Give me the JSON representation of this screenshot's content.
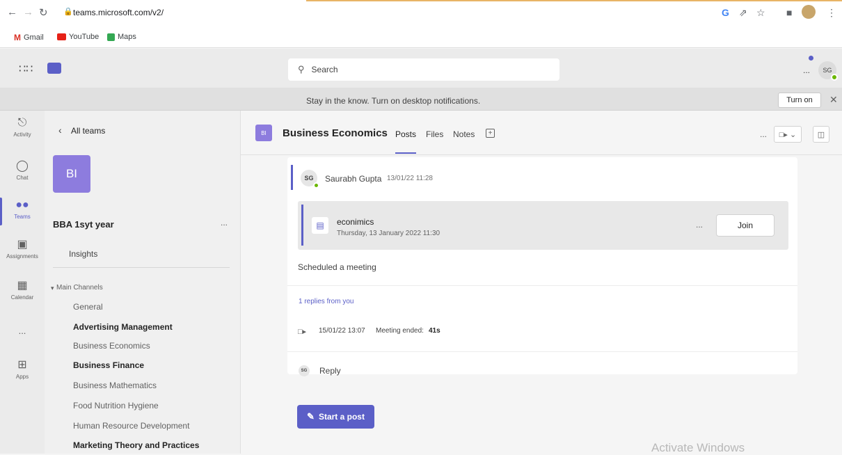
{
  "browser": {
    "url": "teams.microsoft.com/v2/",
    "bookmarks": [
      {
        "label": "Gmail",
        "color": "#d93025"
      },
      {
        "label": "YouTube",
        "color": "#e62117"
      },
      {
        "label": "Maps",
        "color": "#34a853"
      }
    ]
  },
  "header": {
    "search_placeholder": "Search",
    "more_label": "...",
    "avatar_initials": "SG"
  },
  "notification": {
    "text": "Stay in the know. Turn on desktop notifications.",
    "button": "Turn on"
  },
  "rail": {
    "items": [
      {
        "label": "Activity",
        "icon": "bell-icon"
      },
      {
        "label": "Chat",
        "icon": "chat-icon"
      },
      {
        "label": "Teams",
        "icon": "teams-icon",
        "active": true
      },
      {
        "label": "Assignments",
        "icon": "assignments-icon"
      },
      {
        "label": "Calendar",
        "icon": "calendar-icon"
      },
      {
        "label": "...",
        "icon": "more-icon"
      },
      {
        "label": "Apps",
        "icon": "apps-icon"
      }
    ]
  },
  "team": {
    "back_label": "All teams",
    "tile_initials": "BI",
    "name": "BBA 1syt year",
    "more_label": "...",
    "insights": "Insights",
    "section": "Main Channels",
    "channels": [
      {
        "label": "General",
        "bold": false
      },
      {
        "label": "Advertising Management",
        "bold": true
      },
      {
        "label": "Business Economics",
        "bold": false
      },
      {
        "label": "Business Finance",
        "bold": true
      },
      {
        "label": "Business Mathematics",
        "bold": false
      },
      {
        "label": "Food Nutrition Hygiene",
        "bold": false
      },
      {
        "label": "Human Resource Development",
        "bold": false
      },
      {
        "label": "Marketing Theory and Practices",
        "bold": true
      }
    ]
  },
  "channel": {
    "icon_initials": "BI",
    "title": "Business Economics",
    "tabs": [
      "Posts",
      "Files",
      "Notes"
    ],
    "active_tab": "Posts",
    "more_label": "..."
  },
  "post": {
    "author_initials": "SG",
    "author": "Saurabh Gupta",
    "timestamp": "13/01/22 11:28",
    "meeting": {
      "title": "econimics",
      "datetime": "Thursday, 13 January 2022 11:30",
      "more_label": "...",
      "join_label": "Join"
    },
    "message": "Scheduled a meeting",
    "replies_label": "1 replies from you",
    "ended": {
      "time": "15/01/22 13:07",
      "text": "Meeting ended:",
      "duration": "41s"
    },
    "reply_initials": "SG",
    "reply_label": "Reply"
  },
  "start_post": "Start a post",
  "watermark": "Activate Windows",
  "colors": {
    "accent": "#5b5fc7",
    "tile": "#8d7cde",
    "presence": "#6bb700"
  }
}
